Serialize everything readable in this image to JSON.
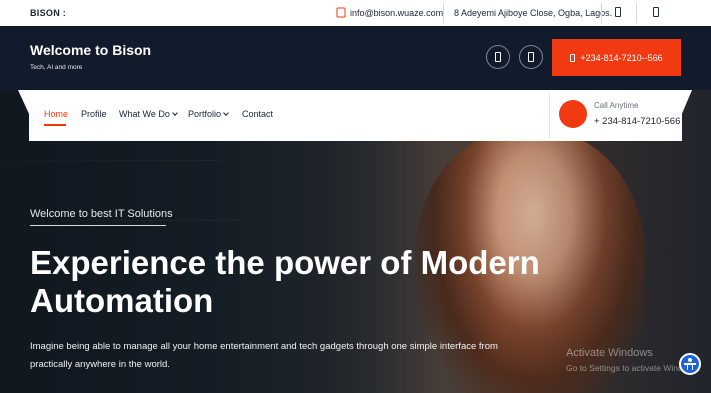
{
  "topbar": {
    "brand": "BISON :",
    "email": "info@bison.wuaze.com",
    "address": "8 Adeyemi Ajiboye Close, Ogba, Lagos."
  },
  "header": {
    "title": "Welcome to Bison",
    "tagline": "Tech, AI and more",
    "call_button": "+234-814-7210--566"
  },
  "nav": {
    "items": [
      {
        "label": "Home",
        "active": true
      },
      {
        "label": "Profile"
      },
      {
        "label": "What We Do",
        "dropdown": true
      },
      {
        "label": "Portfolio",
        "dropdown": true
      },
      {
        "label": "Contact"
      }
    ],
    "call_label": "Call Anytime",
    "call_number": "+ 234-814-7210-566"
  },
  "hero": {
    "subtitle": "Welcome to best IT Solutions",
    "headline": "Experience the power of Modern Automation",
    "description": "Imagine being able to manage all your home entertainment and tech gadgets through one simple interface from practically anywhere in the world."
  },
  "watermark": {
    "title": "Activate Windows",
    "subtitle": "Go to Settings to activate Windows."
  },
  "colors": {
    "accent": "#f23a12",
    "header_bg": "#121b2c",
    "a11y": "#1e63d8"
  }
}
